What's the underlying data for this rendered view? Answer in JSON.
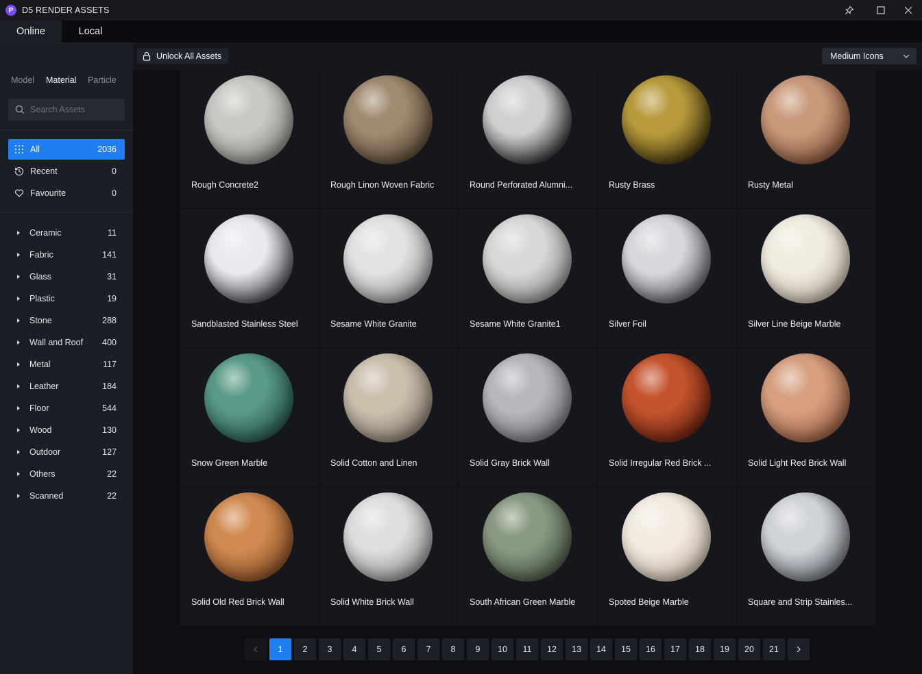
{
  "window": {
    "title": "D5 RENDER ASSETS",
    "logo_letter": "P"
  },
  "top_tabs": [
    {
      "label": "Online"
    },
    {
      "label": "Local"
    }
  ],
  "sidebar": {
    "type_tabs": [
      {
        "label": "Model"
      },
      {
        "label": "Material"
      },
      {
        "label": "Particle"
      }
    ],
    "search": {
      "placeholder": "Search Assets",
      "value": ""
    },
    "quick": [
      {
        "label": "All",
        "count": "2036",
        "icon": "grid-icon"
      },
      {
        "label": "Recent",
        "count": "0",
        "icon": "history-icon"
      },
      {
        "label": "Favourite",
        "count": "0",
        "icon": "heart-icon"
      }
    ],
    "categories": [
      {
        "label": "Ceramic",
        "count": "11"
      },
      {
        "label": "Fabric",
        "count": "141"
      },
      {
        "label": "Glass",
        "count": "31"
      },
      {
        "label": "Plastic",
        "count": "19"
      },
      {
        "label": "Stone",
        "count": "288"
      },
      {
        "label": "Wall and Roof",
        "count": "400"
      },
      {
        "label": "Metal",
        "count": "117"
      },
      {
        "label": "Leather",
        "count": "184"
      },
      {
        "label": "Floor",
        "count": "544"
      },
      {
        "label": "Wood",
        "count": "130"
      },
      {
        "label": "Outdoor",
        "count": "127"
      },
      {
        "label": "Others",
        "count": "22"
      },
      {
        "label": "Scanned",
        "count": "22"
      }
    ]
  },
  "toolbar": {
    "unlock_label": "Unlock All Assets",
    "view_mode": "Medium Icons"
  },
  "assets": [
    {
      "name": "Rough Concrete2",
      "color": "#c9c8c2",
      "shade": "#7d7b75"
    },
    {
      "name": "Rough Linon Woven Fabric",
      "color": "#a08a70",
      "shade": "#4e3e2c"
    },
    {
      "name": "Round Perforated Alumni...",
      "color": "#cfd0d2",
      "shade": "#1a1a1c"
    },
    {
      "name": "Rusty Brass",
      "color": "#b89a3c",
      "shade": "#2e2408"
    },
    {
      "name": "Rusty Metal",
      "color": "#c99a7c",
      "shade": "#7a4a30"
    },
    {
      "name": "Sandblasted Stainless Steel",
      "color": "#e8eaee",
      "shade": "#303338"
    },
    {
      "name": "Sesame White Granite",
      "color": "#e2e2e2",
      "shade": "#8a8a8a"
    },
    {
      "name": "Sesame White Granite1",
      "color": "#d8d9d6",
      "shade": "#7e807c"
    },
    {
      "name": "Silver Foil",
      "color": "#d6d8dc",
      "shade": "#4a4d52"
    },
    {
      "name": "Silver Line Beige Marble",
      "color": "#f1ece0",
      "shade": "#b3ab98"
    },
    {
      "name": "Snow Green Marble",
      "color": "#5a9a88",
      "shade": "#1f4a40"
    },
    {
      "name": "Solid Cotton and Linen",
      "color": "#cbbfae",
      "shade": "#7d7264"
    },
    {
      "name": "Solid Gray Brick Wall",
      "color": "#b8b7bd",
      "shade": "#67656d"
    },
    {
      "name": "Solid Irregular Red Brick ...",
      "color": "#c4542e",
      "shade": "#5a1a0c"
    },
    {
      "name": "Solid Light Red Brick Wall",
      "color": "#d6a080",
      "shade": "#8a5238"
    },
    {
      "name": "Solid Old Red Brick Wall",
      "color": "#d08a50",
      "shade": "#7a4420"
    },
    {
      "name": "Solid White Brick Wall",
      "color": "#dedede",
      "shade": "#858585"
    },
    {
      "name": "South African Green Marble",
      "color": "#8a9a82",
      "shade": "#3c4a3a"
    },
    {
      "name": "Spoted Beige Marble",
      "color": "#f2ebe1",
      "shade": "#b8ab98"
    },
    {
      "name": "Square and Strip Stainles...",
      "color": "#d0d3d8",
      "shade": "#5d6168"
    }
  ],
  "pagination": {
    "current": "1",
    "prev_icon": "chevron-left-icon",
    "next_icon": "chevron-right-icon",
    "pages": [
      "1",
      "2",
      "3",
      "4",
      "5",
      "6",
      "7",
      "8",
      "9",
      "10",
      "11",
      "12",
      "13",
      "14",
      "15",
      "16",
      "17",
      "18",
      "19",
      "20",
      "21"
    ]
  }
}
